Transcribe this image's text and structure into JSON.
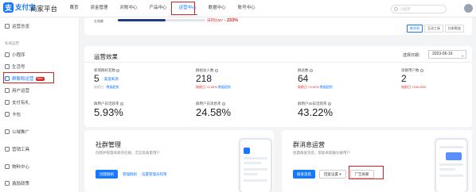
{
  "header": {
    "logo_mark": "支",
    "logo_text": "支付宝",
    "logo_sub": "ALIPAY",
    "platform": "商家平台",
    "nav": [
      {
        "label": "首页",
        "active": false
      },
      {
        "label": "资金管理",
        "active": false
      },
      {
        "label": "对账中心",
        "active": false
      },
      {
        "label": "产品中心",
        "active": false
      },
      {
        "label": "运营中心",
        "active": true
      },
      {
        "label": "数据中心",
        "active": false
      },
      {
        "label": "账号中心",
        "active": false
      }
    ],
    "search_placeholder": "小程序"
  },
  "sidebar": {
    "top_item": "运营总览",
    "group": "私域运营",
    "items": [
      {
        "label": "小程序"
      },
      {
        "label": "生活号"
      },
      {
        "label": "群聊和运营",
        "badge": "New",
        "active": true
      },
      {
        "label": "用户运营"
      },
      {
        "label": "支付有礼"
      },
      {
        "label": "卡包"
      }
    ],
    "bottom": [
      {
        "label": "公域推广"
      },
      {
        "label": "营销工具"
      },
      {
        "label": "物料中心"
      },
      {
        "label": "激励政策"
      }
    ]
  },
  "strip": {
    "label": "交易额",
    "value_prefix": "日环比MY",
    "value": "233%",
    "tabs": [
      "群消息",
      "互动工具",
      "拉新裂变"
    ]
  },
  "effect": {
    "title": "运营效果",
    "date_label": "选择日期：",
    "date_value": "2023-06-16",
    "metrics": [
      {
        "label": "新增群好友数",
        "value": "5",
        "link": "渠道来源",
        "sub_a": "较前日 -",
        "sub_b": "数据趋势"
      },
      {
        "label": "群组总人数",
        "value": "218",
        "link": "",
        "sub_a": "较前日 +2.05%",
        "sub_b": "数据趋势"
      },
      {
        "label": "群总数",
        "value": "64",
        "link": "",
        "sub_a": "较前日 +4.92%",
        "sub_b": "数据趋势"
      },
      {
        "label": "退群用户数",
        "value": "2",
        "link": "",
        "sub_a": "较前日 +100.00%",
        "sub_b": ""
      },
      {
        "label": "群用户日活跃率",
        "value": "5.93%"
      },
      {
        "label": "群用户日消息率",
        "value": "24.58%"
      },
      {
        "label": "群用户30日活跃率",
        "value": "43.22%"
      }
    ]
  },
  "cards": [
    {
      "title": "社群管理",
      "desc": "创建并管理商家的社群，沉淀高质量用户",
      "primary": "创建群组",
      "links": [
        "管理群组",
        "设置管理员权限"
      ]
    },
    {
      "title": "群消息运营",
      "desc": "批量群发消息，帮助商家触达群用户",
      "primary": "群发消息",
      "ghost": [
        "回复设置",
        "广告屏蔽"
      ]
    }
  ]
}
